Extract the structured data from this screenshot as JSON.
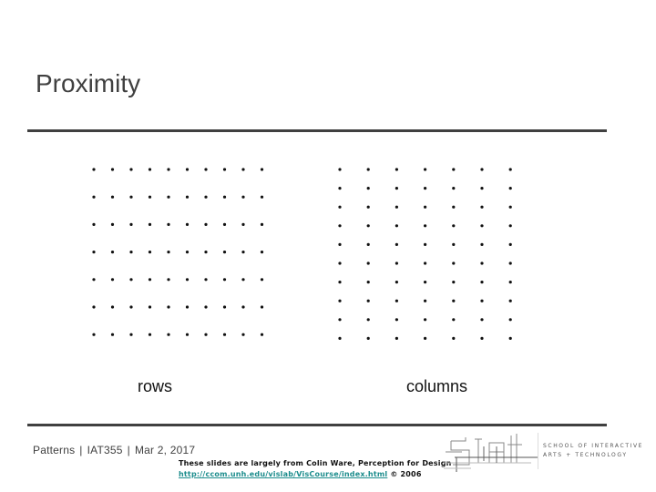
{
  "slide": {
    "title": "Proximity",
    "left_figure": {
      "label": "rows",
      "grid": {
        "columns": 10,
        "rows": 7,
        "grouping": "rows"
      }
    },
    "right_figure": {
      "label": "columns",
      "grid": {
        "columns": 7,
        "rows": 10,
        "grouping": "columns"
      }
    }
  },
  "footer": {
    "course_parts": [
      "Patterns",
      "IAT355",
      "Mar 2, 2017"
    ],
    "separator": "|",
    "credit_text": "These slides are largely from Colin Ware, Perception for Design",
    "credit_link": "http://ccom.unh.edu/vislab/VisCourse/index.html",
    "credit_copyright": "© 2006",
    "logo_text": "SIAT",
    "school_line1": "SCHOOL OF INTERACTIVE",
    "school_line2": "ARTS + TECHNOLOGY"
  },
  "colors": {
    "text_dark": "#404040",
    "link": "#1b8c8c",
    "dot": "#111111"
  }
}
